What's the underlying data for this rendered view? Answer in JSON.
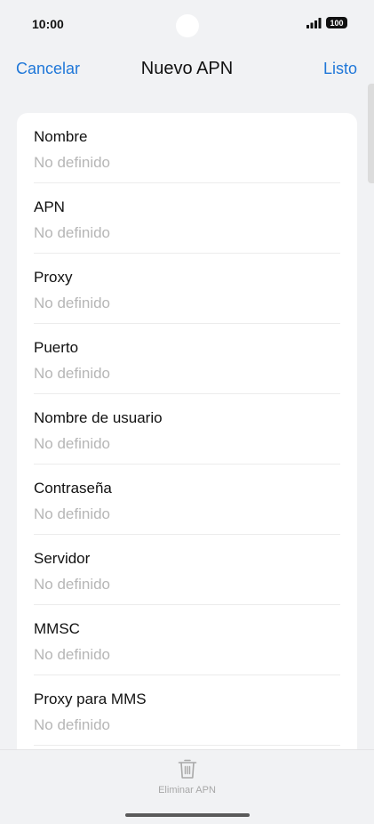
{
  "status_bar": {
    "time": "10:00",
    "battery": "100"
  },
  "header": {
    "cancel_label": "Cancelar",
    "title": "Nuevo APN",
    "done_label": "Listo"
  },
  "fields": [
    {
      "label": "Nombre",
      "value": "No definido"
    },
    {
      "label": "APN",
      "value": "No definido"
    },
    {
      "label": "Proxy",
      "value": "No definido"
    },
    {
      "label": "Puerto",
      "value": "No definido"
    },
    {
      "label": "Nombre de usuario",
      "value": "No definido"
    },
    {
      "label": "Contraseña",
      "value": "No definido"
    },
    {
      "label": "Servidor",
      "value": "No definido"
    },
    {
      "label": "MMSC",
      "value": "No definido"
    },
    {
      "label": "Proxy para MMS",
      "value": "No definido"
    }
  ],
  "bottom_bar": {
    "delete_label": "Eliminar APN",
    "delete_icon": "trash-icon"
  },
  "colors": {
    "accent": "#1f77d8",
    "background": "#f1f2f4",
    "placeholder": "#b6b6b6"
  }
}
